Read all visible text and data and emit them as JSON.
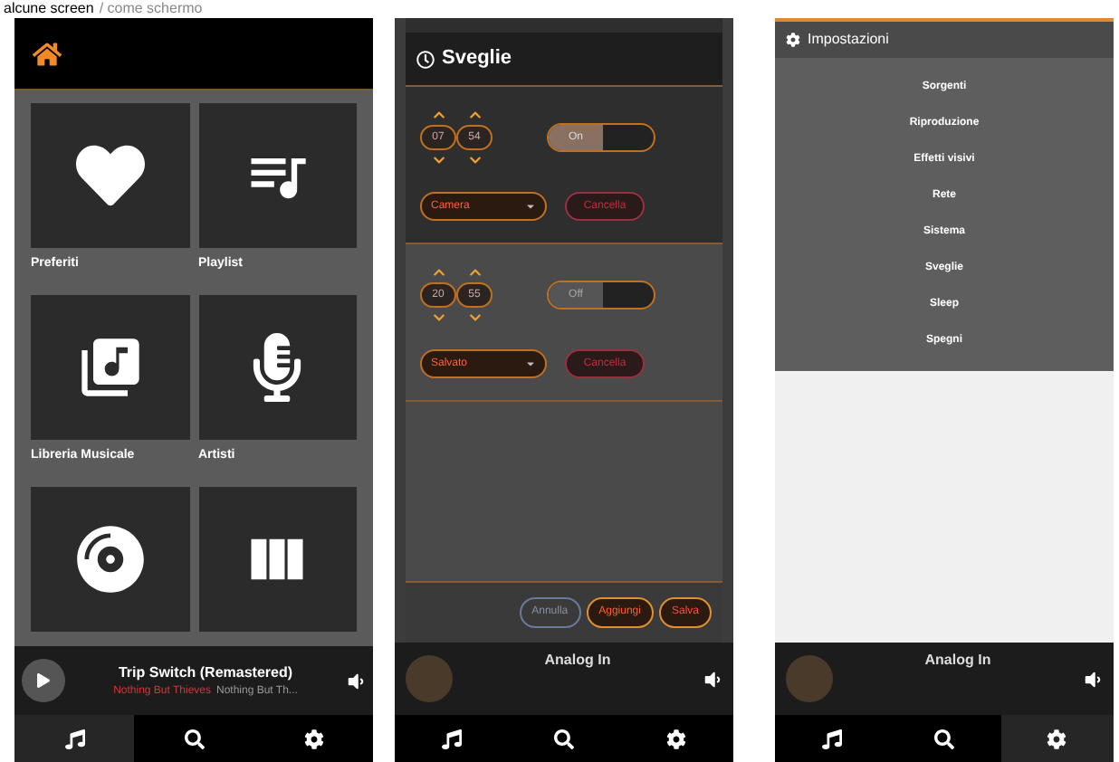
{
  "caption": {
    "bold": "alcune screen",
    "rest": "/ come schermo"
  },
  "screens": [
    {
      "kind": "home",
      "tiles": [
        {
          "label": "Preferiti",
          "kind": "heart"
        },
        {
          "label": "Playlist",
          "kind": "playlist"
        },
        {
          "label": "Libreria Musicale",
          "kind": "library"
        },
        {
          "label": "Artisti",
          "kind": "mic"
        },
        {
          "kind": "album"
        },
        {
          "kind": "box"
        }
      ],
      "player": {
        "title": "Trip Switch (Remastered)",
        "artist": "Nothing But Thieves",
        "album": "Nothing But Th...",
        "playing": false
      },
      "nav": [
        {
          "kind": "music",
          "selected": true
        },
        {
          "kind": "search",
          "selected": false
        },
        {
          "kind": "settings",
          "selected": false
        }
      ]
    },
    {
      "kind": "alarms",
      "title": "Sveglie",
      "alarms": [
        {
          "hour": "07",
          "minute": "54",
          "toggle": "On",
          "on": true,
          "source": "Camera",
          "delete": "Cancella"
        },
        {
          "hour": "20",
          "minute": "55",
          "toggle": "Off",
          "on": false,
          "source": "Salvato",
          "delete": "Cancella"
        }
      ],
      "buttons": [
        {
          "label": "Annulla",
          "kind": "neutral"
        },
        {
          "label": "Aggiungi",
          "kind": "primary"
        },
        {
          "label": "Salva",
          "kind": "danger"
        }
      ],
      "player": {
        "title": "Analog In"
      },
      "nav": [
        {
          "kind": "music",
          "selected": false
        },
        {
          "kind": "search",
          "selected": false
        },
        {
          "kind": "settings",
          "selected": false
        }
      ]
    },
    {
      "kind": "settings",
      "title": "Impostazioni",
      "items": [
        "Sorgenti",
        "Riproduzione",
        "Effetti visivi",
        "Rete",
        "Sistema",
        "Sveglie",
        "Sleep",
        "Spegni"
      ],
      "player": {
        "title": "Analog In"
      },
      "nav": [
        {
          "kind": "music",
          "selected": false
        },
        {
          "kind": "search",
          "selected": false
        },
        {
          "kind": "settings",
          "selected": true
        }
      ]
    }
  ]
}
